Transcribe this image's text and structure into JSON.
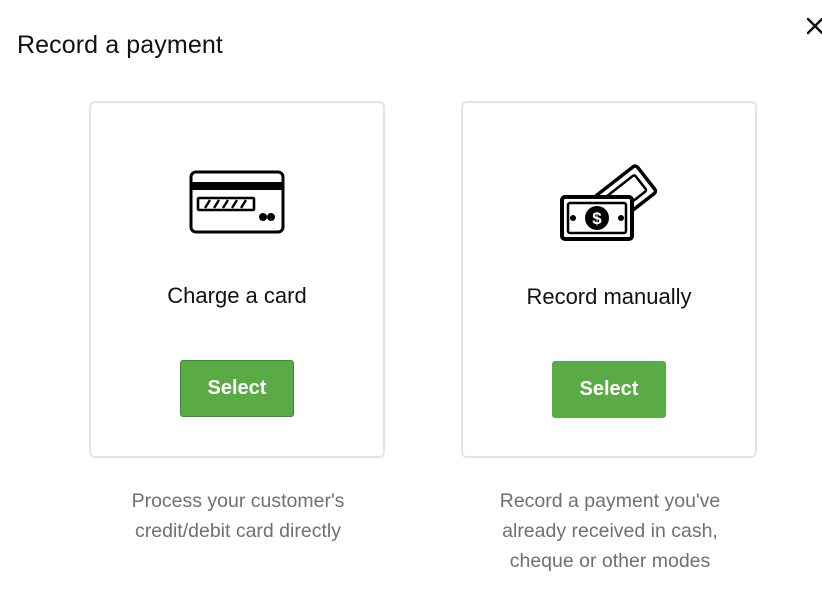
{
  "modal": {
    "title": "Record a payment",
    "close_icon": "close-icon"
  },
  "options": [
    {
      "icon": "credit-card-icon",
      "label": "Charge a card",
      "button_label": "Select",
      "description_lines": [
        "Process your customer's",
        "credit/debit card directly"
      ]
    },
    {
      "icon": "cash-icon",
      "label": "Record manually",
      "button_label": "Select",
      "description_lines": [
        "Record a payment you've",
        "already received in cash,",
        "cheque or other modes"
      ]
    }
  ],
  "colors": {
    "accent_green": "#5aaa46",
    "card_border": "#e3e3e3",
    "description_text": "#6b7178"
  }
}
